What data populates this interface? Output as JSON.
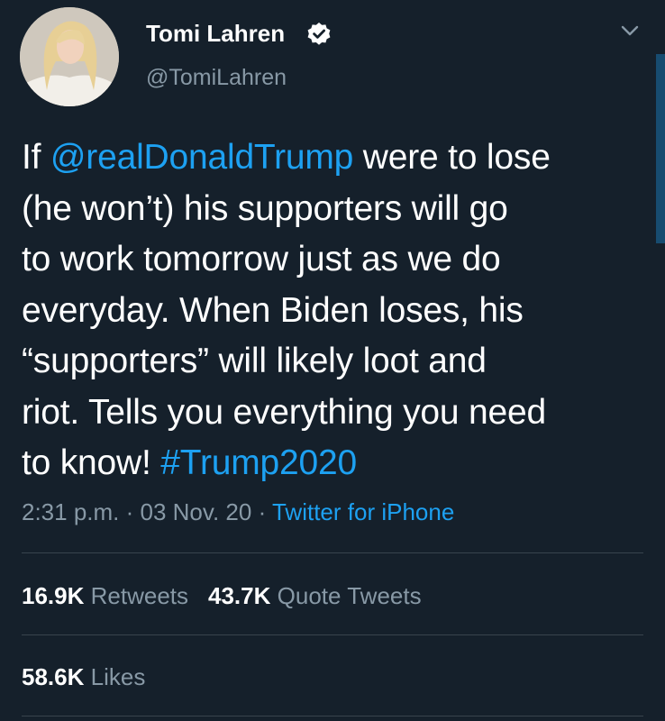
{
  "user": {
    "display_name": "Tomi Lahren",
    "handle": "@TomiLahren",
    "verified": true,
    "avatar_icon": "profile-photo"
  },
  "tweet": {
    "lines": [
      [
        {
          "text": "If ",
          "link": false
        },
        {
          "text": "@realDonaldTrump",
          "link": true
        },
        {
          "text": " were to lose",
          "link": false
        }
      ],
      [
        {
          "text": "(he won’t) his supporters will go",
          "link": false
        }
      ],
      [
        {
          "text": "to work tomorrow just as we do",
          "link": false
        }
      ],
      [
        {
          "text": "everyday. When Biden loses, his",
          "link": false
        }
      ],
      [
        {
          "text": "“supporters” will likely loot and",
          "link": false
        }
      ],
      [
        {
          "text": "riot. Tells you everything you need",
          "link": false
        }
      ],
      [
        {
          "text": "to know! ",
          "link": false
        },
        {
          "text": "#Trump2020",
          "link": true
        }
      ]
    ],
    "time": "2:31 p.m.",
    "date": "03 Nov. 20",
    "separator": " · ",
    "source": "Twitter for iPhone"
  },
  "stats": {
    "retweets_count": "16.9K",
    "retweets_label": "Retweets",
    "quote_count": "43.7K",
    "quote_label": "Quote Tweets",
    "likes_count": "58.6K",
    "likes_label": "Likes"
  },
  "colors": {
    "background": "#15202b",
    "text": "#ffffff",
    "secondary": "#8899a6",
    "accent": "#1da1f2",
    "divider": "#38444d"
  }
}
